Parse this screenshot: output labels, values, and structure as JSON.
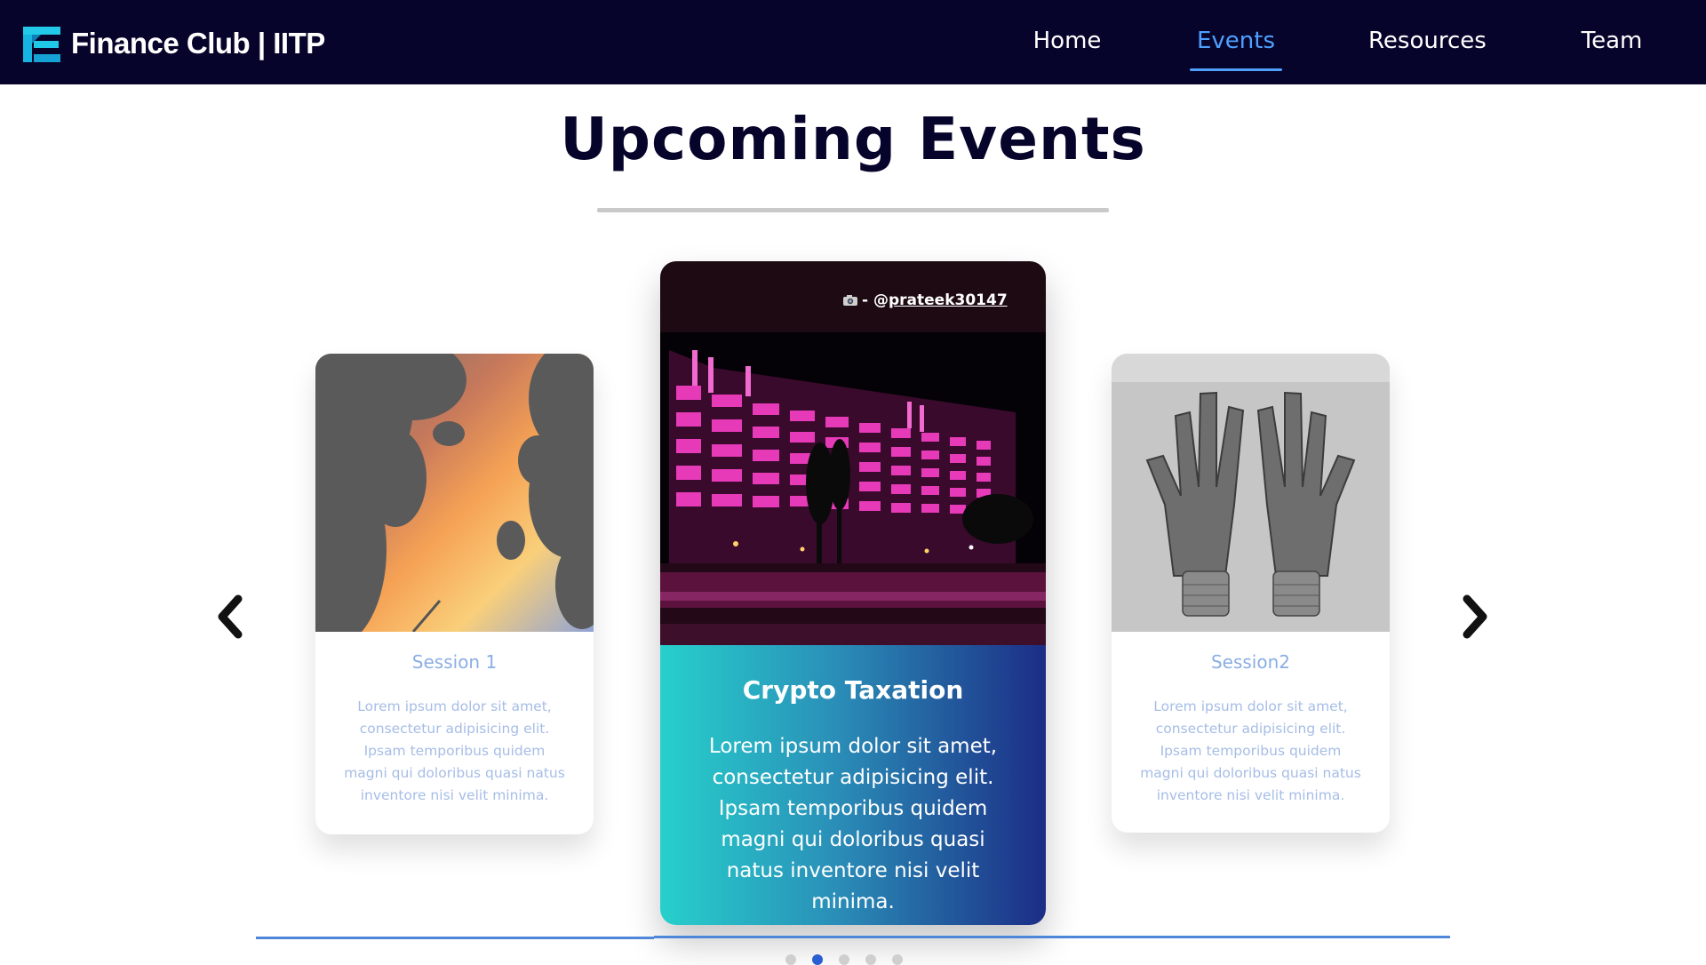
{
  "brand": {
    "name": "Finance Club | IITP",
    "logo_icon": "finance-club-logo-icon",
    "logo_color": "#1ec8e6"
  },
  "nav": {
    "items": [
      {
        "label": "Home",
        "active": false
      },
      {
        "label": "Events",
        "active": true
      },
      {
        "label": "Resources",
        "active": false
      },
      {
        "label": "Team",
        "active": false
      }
    ],
    "active_color": "#4ea0ff",
    "background": "#07042b"
  },
  "section": {
    "title": "Upcoming Events"
  },
  "cards": {
    "left": {
      "title": "Session 1",
      "text": "Lorem ipsum dolor sit amet, consectetur adipisicing elit. Ipsam temporibus quidem magni qui doloribus quasi natus inventore nisi velit minima.",
      "image": "sunset-silhouette-image"
    },
    "center": {
      "title": "Crypto Taxation",
      "text": "Lorem ipsum dolor sit amet, consectetur adipisicing elit. Ipsam temporibus quidem magni qui doloribus quasi natus inventore nisi velit minima.",
      "image": "illuminated-building-night-image",
      "photo_credit_prefix": "- @",
      "photo_credit_handle": "prateek30147",
      "gradient": [
        "#27d0cc",
        "#1c2d86"
      ]
    },
    "right": {
      "title": "Session2",
      "text": "Lorem ipsum dolor sit amet, consectetur adipisicing elit. Ipsam temporibus quidem magni qui doloribus quasi natus inventore nisi velit minima.",
      "image": "henna-hands-image"
    }
  },
  "carousel": {
    "prev_icon": "chevron-left-icon",
    "next_icon": "chevron-right-icon",
    "dot_count": 5,
    "active_dot": 2
  }
}
